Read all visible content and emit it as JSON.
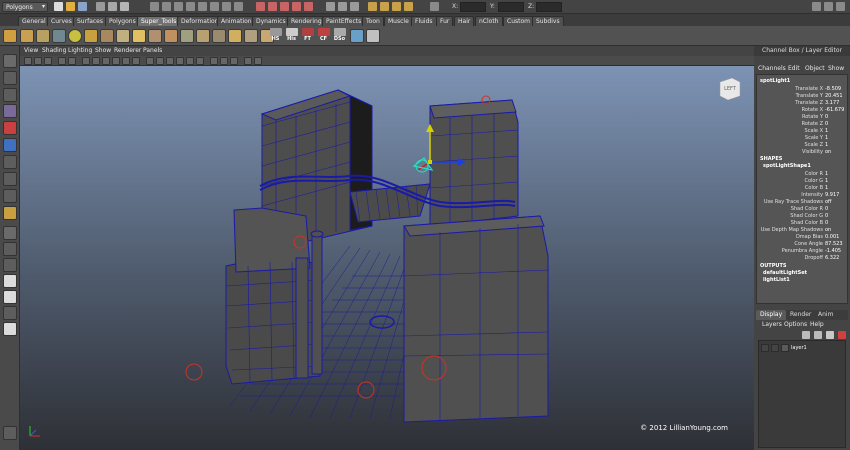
{
  "status_line": {
    "mode": "Polygons",
    "coord_labels": [
      "X:",
      "Y:",
      "Z:"
    ],
    "coord_values": [
      "",
      "",
      ""
    ]
  },
  "shelf_tabs": [
    "General",
    "Curves",
    "Surfaces",
    "Polygons",
    "Super_Tools",
    "Deformation",
    "Animation",
    "Dynamics",
    "Rendering",
    "PaintEffects",
    "Toon",
    "Muscle",
    "Fluids",
    "Fur",
    "Hair",
    "nCloth",
    "Custom",
    "Subdivs"
  ],
  "active_shelf_tab": "Super_Tools",
  "shelf_text_icons": [
    "HS",
    "His",
    "FT",
    "CF",
    "DSo"
  ],
  "viewport": {
    "menu": [
      "View",
      "Shading",
      "Lighting",
      "Show",
      "Renderer",
      "Panels"
    ],
    "view_cube_label": "LEFT",
    "copyright": "© 2012 LillianYoung.com"
  },
  "channel_box": {
    "header": "Channel Box / Layer Editor",
    "menu": [
      "Channels",
      "Edit",
      "Object",
      "Show"
    ],
    "node": "spotLight1",
    "attributes": [
      {
        "name": "Translate X",
        "value": "-8.509"
      },
      {
        "name": "Translate Y",
        "value": "20.451"
      },
      {
        "name": "Translate Z",
        "value": "3.177"
      },
      {
        "name": "Rotate X",
        "value": "-61.679"
      },
      {
        "name": "Rotate Y",
        "value": "0"
      },
      {
        "name": "Rotate Z",
        "value": "0"
      },
      {
        "name": "Scale X",
        "value": "1"
      },
      {
        "name": "Scale Y",
        "value": "1"
      },
      {
        "name": "Scale Z",
        "value": "1"
      },
      {
        "name": "Visibility",
        "value": "on"
      }
    ],
    "shapes_label": "SHAPES",
    "shape_node": "spotLightShape1",
    "shape_attributes": [
      {
        "name": "Color R",
        "value": "1"
      },
      {
        "name": "Color G",
        "value": "1"
      },
      {
        "name": "Color B",
        "value": "1"
      },
      {
        "name": "Intensity",
        "value": "9.917"
      },
      {
        "name": "Use Ray Trace Shadows",
        "value": "off"
      },
      {
        "name": "Shad Color R",
        "value": "0"
      },
      {
        "name": "Shad Color G",
        "value": "0"
      },
      {
        "name": "Shad Color B",
        "value": "0"
      },
      {
        "name": "Use Depth Map Shadows",
        "value": "on"
      },
      {
        "name": "Dmap Bias",
        "value": "0.001"
      },
      {
        "name": "Cone Angle",
        "value": "87.523"
      },
      {
        "name": "Penumbra Angle",
        "value": "-1.405"
      },
      {
        "name": "Dropoff",
        "value": "6.322"
      }
    ],
    "outputs_label": "OUTPUTS",
    "outputs": [
      "defaultLightSet",
      "lightList1"
    ]
  },
  "layer_editor": {
    "tabs": [
      "Display",
      "Render",
      "Anim"
    ],
    "active_tab": "Display",
    "menu": [
      "Layers",
      "Options",
      "Help"
    ],
    "layers": [
      {
        "name": "layer1"
      }
    ]
  },
  "colors": {
    "wireframe": "#1a1aa8",
    "selected_light": "#22e0c0",
    "light_gizmo": "#cc3322"
  }
}
